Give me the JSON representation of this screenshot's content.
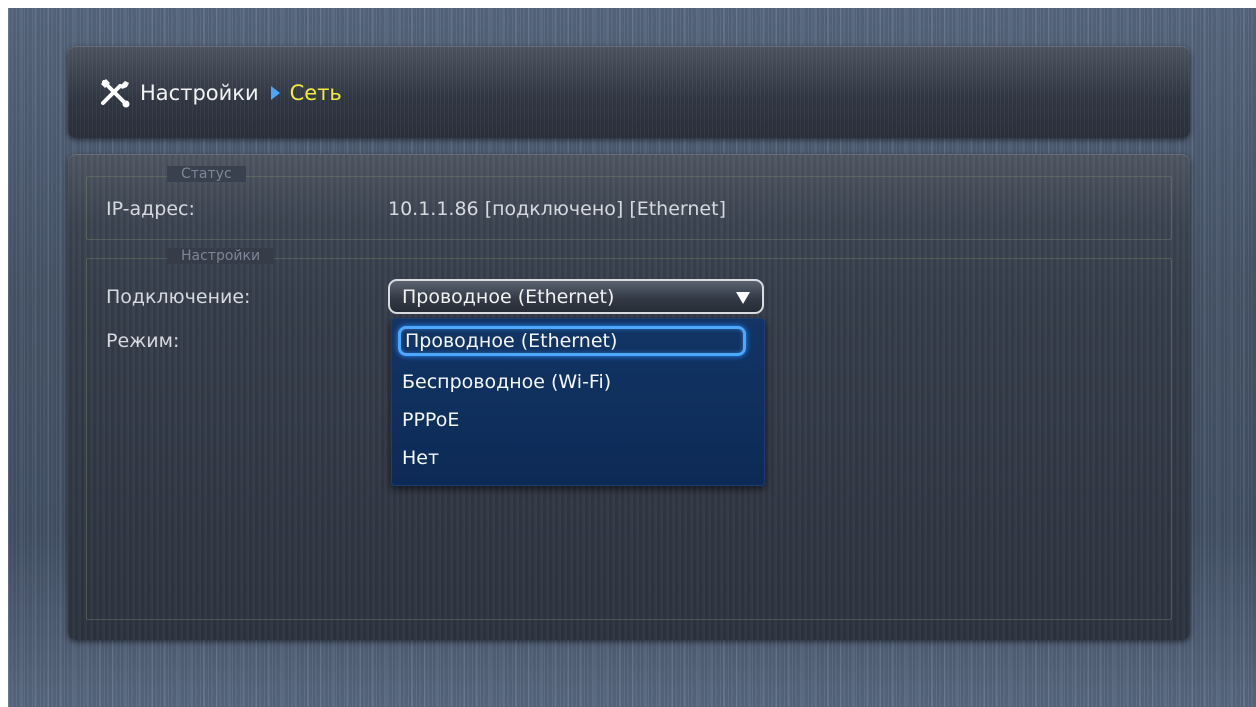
{
  "breadcrumb": {
    "icon": "tools-icon",
    "root": "Настройки",
    "current": "Сеть",
    "current_color": "#f4ea3c",
    "separator_color": "#4aa6ff"
  },
  "status_section": {
    "legend": "Статус",
    "ip_label": "IP-адрес:",
    "ip_value": "10.1.1.86 [подключено] [Ethernet]"
  },
  "settings_section": {
    "legend": "Настройки",
    "connection_label": "Подключение:",
    "connection_value": "Проводное (Ethernet)",
    "mode_label": "Режим:"
  },
  "connection_dropdown": {
    "open": true,
    "selected": "Проводное (Ethernet)",
    "options": [
      "Проводное (Ethernet)",
      "Беспроводное (Wi-Fi)",
      "PPPoE",
      "Нет"
    ],
    "highlight_color": "#4fa8ff"
  }
}
